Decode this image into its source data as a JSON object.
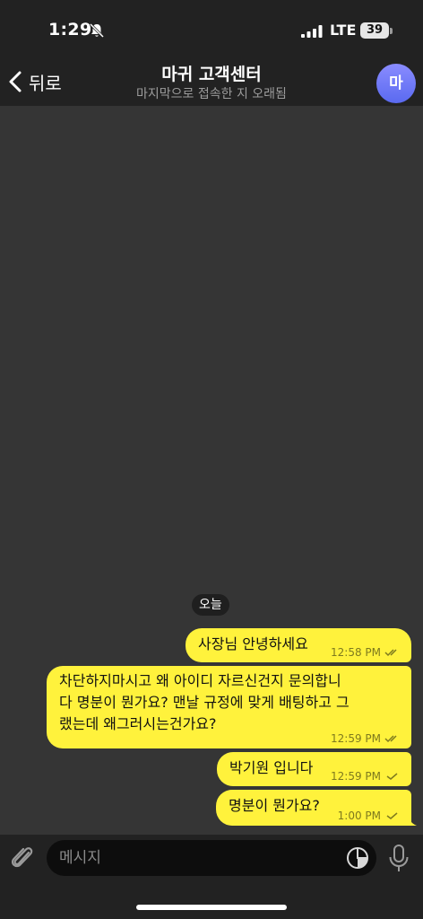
{
  "status_bar": {
    "time": "1:29",
    "network": "LTE",
    "battery": "39"
  },
  "header": {
    "back_label": "뒤로",
    "title": "마귀 고객센터",
    "subtitle": "마지막으로 접속한 지 오래됨",
    "avatar_initial": "마"
  },
  "chat": {
    "date_label": "오늘",
    "messages": [
      {
        "text": "사장님 안녕하세요",
        "time": "12:58 PM",
        "status": "read"
      },
      {
        "text_lines": [
          "차단하지마시고 왜 아이디 자르신건지 문의합니",
          "다 명분이 뭔가요? 맨날 규정에 맞게 배팅하고 그",
          "랬는데 왜그러시는건가요?"
        ],
        "time": "12:59 PM",
        "status": "read"
      },
      {
        "text": "박기원 입니다",
        "time": "12:59 PM",
        "status": "sent"
      },
      {
        "text": "명분이 뭔가요?",
        "time": "1:00 PM",
        "status": "sent"
      }
    ]
  },
  "input": {
    "placeholder": "메시지"
  },
  "colors": {
    "bubble": "#fff23c",
    "bar_background": "#222222",
    "chat_background": "#353535",
    "avatar": "#6e7bf6"
  }
}
